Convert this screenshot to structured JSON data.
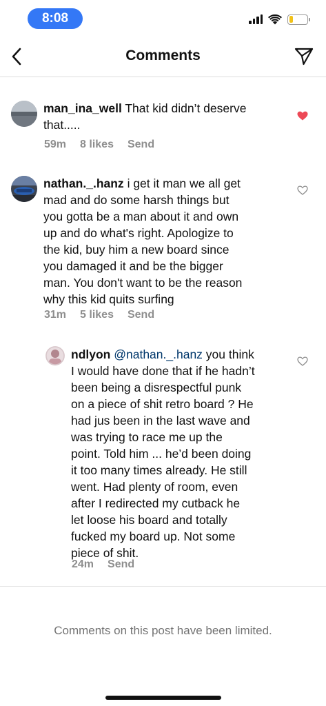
{
  "status_bar": {
    "time": "8:08",
    "battery_level": 0.2,
    "battery_color": "#f2c218",
    "time_pill_color": "#3478f6"
  },
  "header": {
    "title": "Comments",
    "back_icon": "chevron-left-icon",
    "share_icon": "paper-plane-icon"
  },
  "comments": [
    {
      "username": "man_ina_well",
      "text_lines": [
        "That kid didn’t deserve",
        "that....."
      ],
      "time": "59m",
      "likes": "8 likes",
      "reply": "Send",
      "liked": true,
      "like_color": "#ed4956"
    },
    {
      "username": "nathan._.hanz",
      "text_lines": [
        "i get it man we all get",
        "mad and do some harsh things but",
        "you gotta be a man about it and own",
        "up and do what's right. Apologize to",
        "the kid, buy him a new board since",
        "you damaged it and be the bigger",
        "man. You don't want to be the reason",
        "why this kid quits surfing"
      ],
      "time": "31m",
      "likes": "5 likes",
      "reply": "Send",
      "liked": false
    },
    {
      "username": "ndlyon",
      "mention": "@nathan._.hanz",
      "text_lines": [
        " you think",
        "I would have done that if he hadn’t",
        "been being a disrespectful punk",
        "on a piece of shit retro board ? He",
        "had jus been in the last wave and",
        "was trying to race me up the",
        "point.  Told him ... he’d been doing",
        "it too many times already.  He still",
        "went. Had plenty of room, even",
        "after I redirected my cutback he",
        "let loose his board and totally",
        "fucked my board up.  Not some",
        "piece of shit."
      ],
      "time": "24m",
      "reply": "Send",
      "liked": false
    }
  ],
  "footer": {
    "limited_note": "Comments on this post have been limited."
  }
}
